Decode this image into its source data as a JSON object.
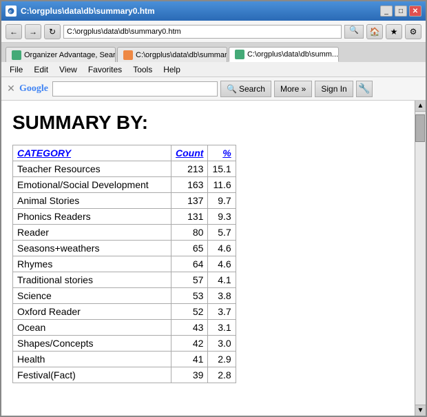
{
  "window": {
    "title": "C:\\orgplus\\data\\db\\summary0.htm",
    "title_bar_text": "C:\\orgplus\\data\\db\\summary0.htm"
  },
  "address_bar": {
    "url": "C:\\orgplus\\data\\db\\summary0.htm",
    "refresh_icon": "↻",
    "back_icon": "←",
    "forward_icon": "→"
  },
  "tabs": [
    {
      "label": "Organizer Advantage, Search, ...",
      "active": false,
      "icon_color": "#4a7"
    },
    {
      "label": "C:\\orgplus\\data\\db\\summary...",
      "active": false,
      "icon_color": "#e84"
    },
    {
      "label": "C:\\orgplus\\data\\db\\summ...",
      "active": true,
      "icon_color": "#4a7"
    }
  ],
  "menu": {
    "items": [
      "File",
      "Edit",
      "View",
      "Favorites",
      "Tools",
      "Help"
    ]
  },
  "toolbar": {
    "close_icon": "✕",
    "google_label": "Google",
    "search_input_value": "",
    "search_button_label": "Search",
    "more_button_label": "More »",
    "signin_label": "Sign In",
    "settings_icon": "🔧"
  },
  "page": {
    "title": "SUMMARY BY:",
    "table": {
      "headers": {
        "category": "CATEGORY",
        "count": "Count",
        "percent": "%"
      },
      "rows": [
        {
          "category": "Teacher Resources",
          "count": "213",
          "percent": "15.1"
        },
        {
          "category": "Emotional/Social Development",
          "count": "163",
          "percent": "11.6"
        },
        {
          "category": "Animal Stories",
          "count": "137",
          "percent": "9.7"
        },
        {
          "category": "Phonics Readers",
          "count": "131",
          "percent": "9.3"
        },
        {
          "category": "Reader",
          "count": "80",
          "percent": "5.7"
        },
        {
          "category": "Seasons+weathers",
          "count": "65",
          "percent": "4.6"
        },
        {
          "category": "Rhymes",
          "count": "64",
          "percent": "4.6"
        },
        {
          "category": "Traditional stories",
          "count": "57",
          "percent": "4.1"
        },
        {
          "category": "Science",
          "count": "53",
          "percent": "3.8"
        },
        {
          "category": "Oxford Reader",
          "count": "52",
          "percent": "3.7"
        },
        {
          "category": "Ocean",
          "count": "43",
          "percent": "3.1"
        },
        {
          "category": "Shapes/Concepts",
          "count": "42",
          "percent": "3.0"
        },
        {
          "category": "Health",
          "count": "41",
          "percent": "2.9"
        },
        {
          "category": "Festival(Fact)",
          "count": "39",
          "percent": "2.8"
        }
      ]
    }
  },
  "scrollbar": {
    "up_icon": "▲",
    "down_icon": "▼"
  }
}
